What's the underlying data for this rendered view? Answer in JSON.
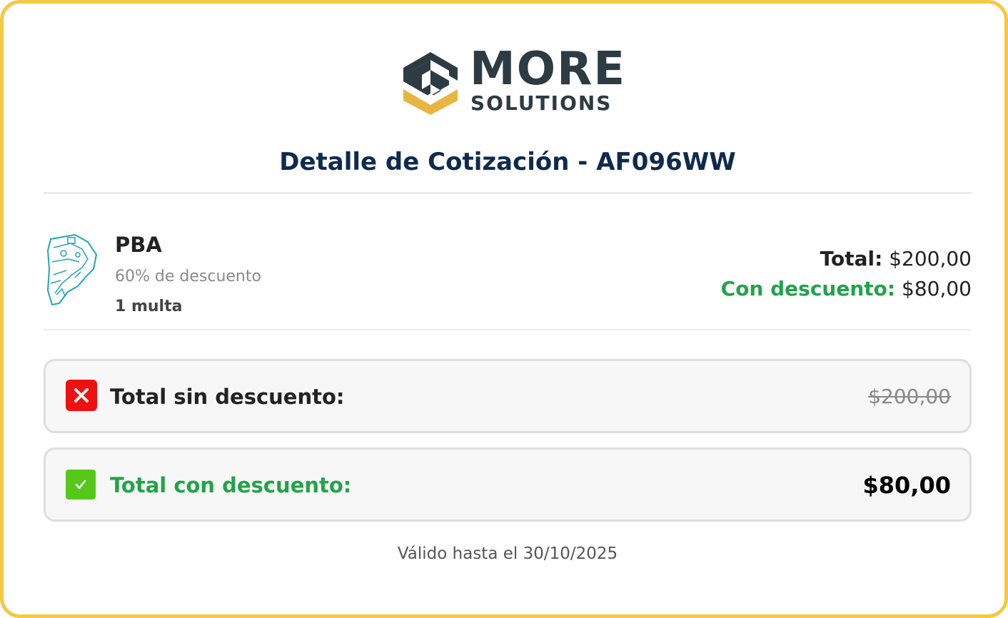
{
  "brand": {
    "name": "MORE",
    "subname": "SOLUTIONS",
    "colors": {
      "dark": "#2d3b43",
      "gold": "#e8b640"
    }
  },
  "title": "Detalle de Cotización - AF096WW",
  "item": {
    "icon": "pba-map-icon",
    "name": "PBA",
    "discount_text": "60% de descuento",
    "count_text": "1 multa",
    "total_label": "Total:",
    "total_value": "$200,00",
    "discounted_label": "Con descuento:",
    "discounted_value": "$80,00"
  },
  "summary": {
    "without_discount": {
      "icon": "x-mark-icon",
      "label": "Total sin descuento:",
      "value": "$200,00"
    },
    "with_discount": {
      "icon": "check-mark-icon",
      "label": "Total con descuento:",
      "value": "$80,00"
    }
  },
  "footer": "Válido hasta el 30/10/2025",
  "colors": {
    "border": "#f5c842",
    "title": "#0f2a4f",
    "green": "#22a34a",
    "red": "#ee1111",
    "check_bg": "#55c81a"
  }
}
